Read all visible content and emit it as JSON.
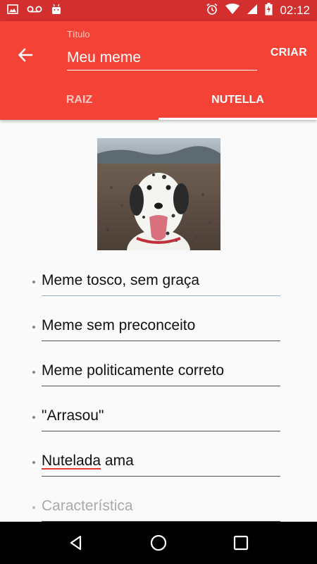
{
  "status_bar": {
    "time": "02:12",
    "icons": [
      "image-icon",
      "voicemail-icon",
      "android-icon",
      "alarm-icon",
      "wifi-icon",
      "signal-icon",
      "battery-charging-icon"
    ]
  },
  "app_bar": {
    "title_label": "Título",
    "title_value": "Meu meme",
    "action_label": "CRIAR",
    "back_icon": "arrow-back-icon"
  },
  "tabs": [
    {
      "label": "RAIZ",
      "active": false
    },
    {
      "label": "NUTELLA",
      "active": true
    }
  ],
  "traits": [
    {
      "value": "Meme tosco, sem graça"
    },
    {
      "value": "Meme sem preconceito"
    },
    {
      "value": "Meme politicamente correto"
    },
    {
      "value": "\"Arrasou\""
    },
    {
      "value_misspelled": "Nutelada",
      "value_rest": " ama"
    }
  ],
  "new_trait": {
    "placeholder": "Característica"
  },
  "nav": [
    "back-triangle-icon",
    "home-circle-icon",
    "recents-square-icon"
  ],
  "colors": {
    "primary": "#f44336",
    "primary_dark": "#d32f2f"
  }
}
